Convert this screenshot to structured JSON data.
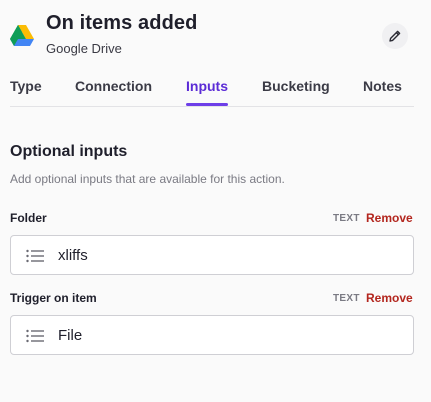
{
  "header": {
    "title": "On items added",
    "subtitle": "Google Drive",
    "logo_icon": "google-drive-icon",
    "edit_icon": "pencil-icon"
  },
  "tabs": [
    {
      "label": "Type",
      "active": false
    },
    {
      "label": "Connection",
      "active": false
    },
    {
      "label": "Inputs",
      "active": true
    },
    {
      "label": "Bucketing",
      "active": false
    },
    {
      "label": "Notes",
      "active": false
    }
  ],
  "section": {
    "title": "Optional inputs",
    "description": "Add optional inputs that are available for this action."
  },
  "fields": [
    {
      "label": "Folder",
      "type": "TEXT",
      "remove_label": "Remove",
      "value": "xliffs",
      "icon": "list-icon"
    },
    {
      "label": "Trigger on item",
      "type": "TEXT",
      "remove_label": "Remove",
      "value": "File",
      "icon": "list-icon"
    }
  ],
  "colors": {
    "accent": "#6d3ee8",
    "remove": "#b3261e"
  }
}
